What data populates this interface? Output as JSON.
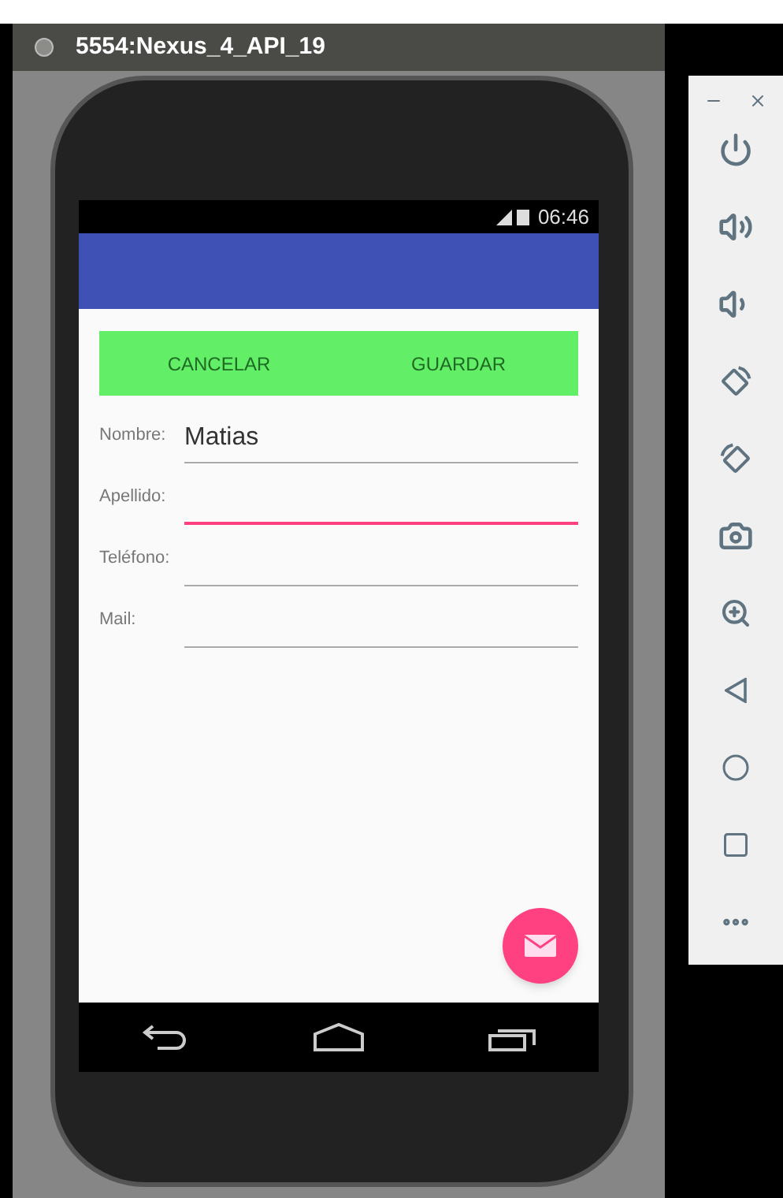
{
  "window": {
    "title": "5554:Nexus_4_API_19"
  },
  "status_bar": {
    "time": "06:46"
  },
  "buttons": [
    "CANCELAR",
    "GUARDAR"
  ],
  "fields": [
    {
      "label": "Nombre:",
      "value": "Matias",
      "focused": false
    },
    {
      "label": "Apellido:",
      "focused": true
    },
    {
      "label": "Teléfono:",
      "focused": false
    },
    {
      "label": "Mail:",
      "focused": false
    }
  ]
}
